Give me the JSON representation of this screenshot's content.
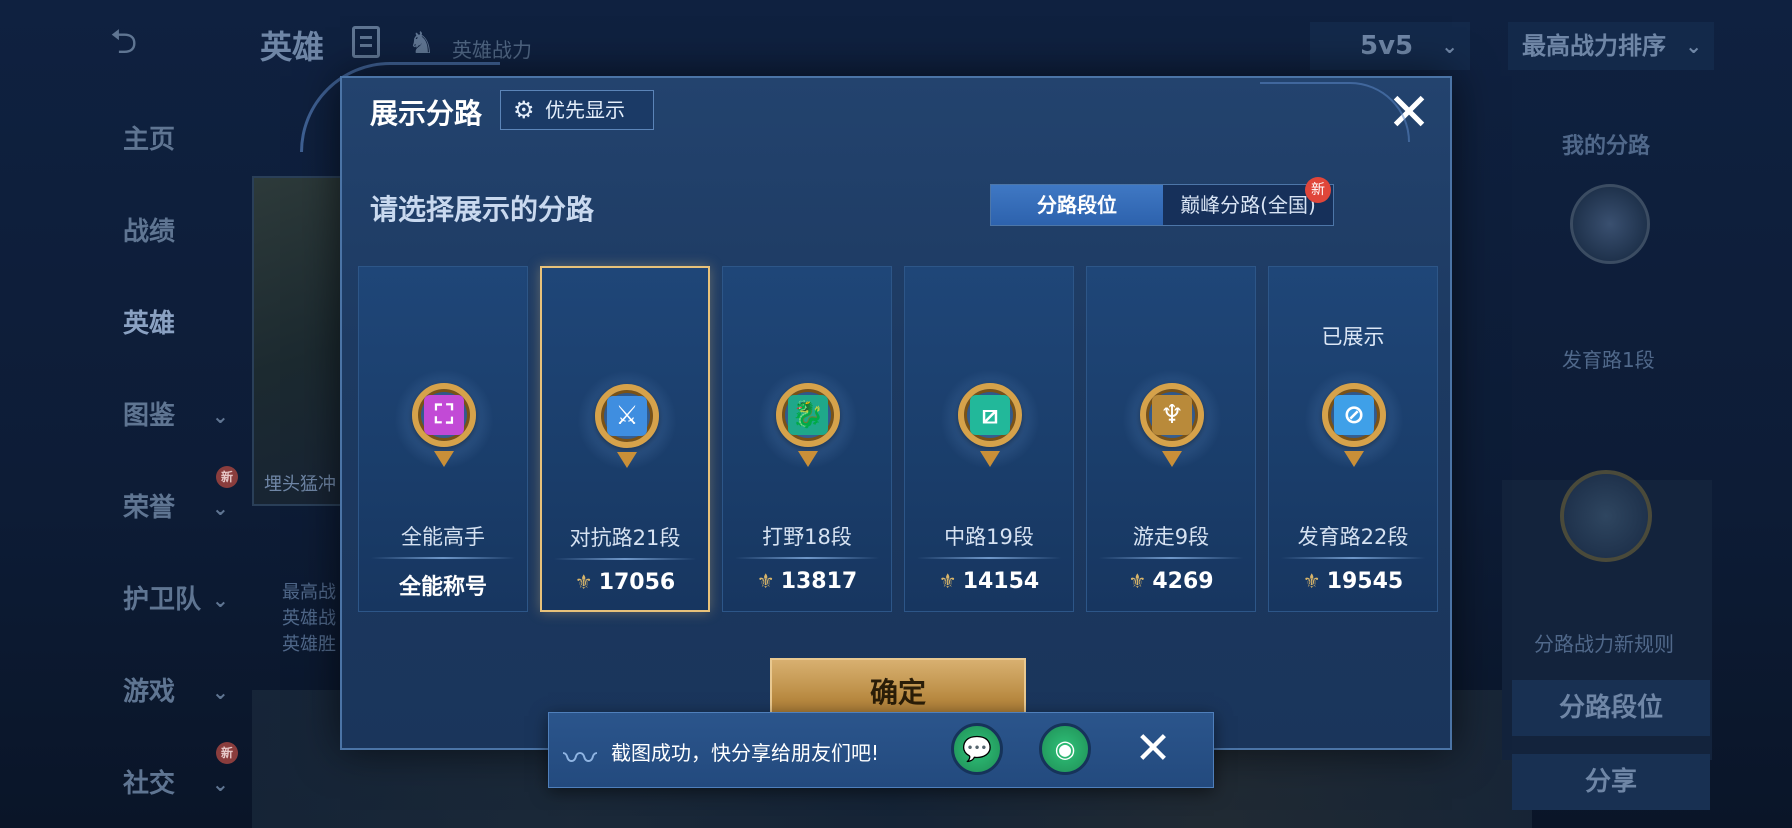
{
  "background": {
    "title": "英雄",
    "power_label": "英雄战力",
    "mode": "5v5",
    "sort": "最高战力排序",
    "nav": [
      {
        "label": "主页"
      },
      {
        "label": "战绩"
      },
      {
        "label": "英雄"
      },
      {
        "label": "图鉴"
      },
      {
        "label": "荣誉",
        "badge": "新"
      },
      {
        "label": "护卫队"
      },
      {
        "label": "游戏"
      },
      {
        "label": "社交",
        "badge": "新"
      }
    ],
    "hero_caption": "埋头猛冲",
    "hero_sub_lines": [
      "最高战",
      "英雄战",
      "英雄胜"
    ],
    "right_panel": {
      "title": "我的分路",
      "lane_label": "发育路1段",
      "rule_text": "分路战力新规则",
      "lane_rank_btn": "分路段位",
      "share_btn": "分享"
    }
  },
  "modal": {
    "title": "展示分路",
    "priority_btn": "优先显示",
    "prompt": "请选择展示的分路",
    "tabs": [
      {
        "label": "分路段位",
        "active": true
      },
      {
        "label": "巅峰分路(全国)",
        "active": false,
        "badge": "新"
      }
    ],
    "cards": [
      {
        "name": "全能高手",
        "value": "全能称号",
        "icon": "all-round-emblem",
        "core": "⛶",
        "core_color": "#c24ad6",
        "selected": false,
        "shown": "",
        "has_power_icon": false
      },
      {
        "name": "对抗路21段",
        "value": "17056",
        "icon": "clash-lane-emblem",
        "core": "⚔",
        "core_color": "#3f8ee0",
        "selected": true,
        "shown": "",
        "has_power_icon": true
      },
      {
        "name": "打野18段",
        "value": "13817",
        "icon": "jungle-emblem",
        "core": "🐉",
        "core_color": "#1fa88a",
        "selected": false,
        "shown": "",
        "has_power_icon": true
      },
      {
        "name": "中路19段",
        "value": "14154",
        "icon": "mid-lane-emblem",
        "core": "⧄",
        "core_color": "#22b89a",
        "selected": false,
        "shown": "",
        "has_power_icon": true
      },
      {
        "name": "游走9段",
        "value": "4269",
        "icon": "roam-emblem",
        "core": "♆",
        "core_color": "#b98a3a",
        "selected": false,
        "shown": "",
        "has_power_icon": true
      },
      {
        "name": "发育路22段",
        "value": "19545",
        "icon": "farm-lane-emblem",
        "core": "⊘",
        "core_color": "#3fa0e8",
        "selected": false,
        "shown": "已展示",
        "has_power_icon": true
      }
    ],
    "confirm": "确定"
  },
  "toast": {
    "text": "截图成功，快分享给朋友们吧!",
    "wechat": "💬",
    "moments": "◉",
    "close": "✕"
  }
}
